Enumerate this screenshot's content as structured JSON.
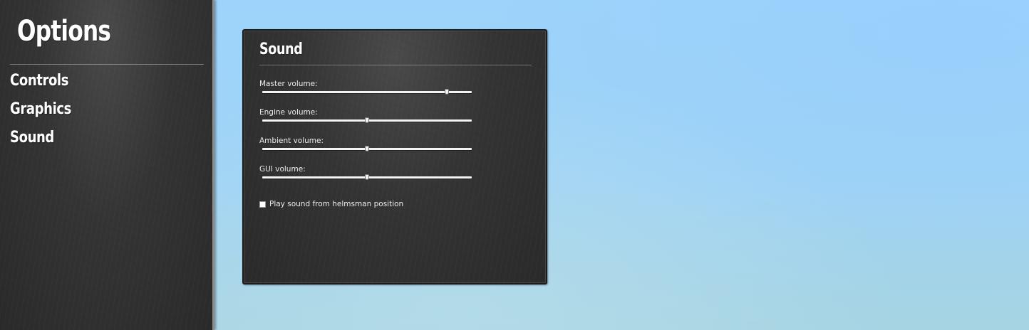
{
  "sidebar": {
    "title": "Options",
    "items": [
      {
        "label": "Controls"
      },
      {
        "label": "Graphics"
      },
      {
        "label": "Sound"
      }
    ]
  },
  "sound_panel": {
    "title": "Sound",
    "sliders": [
      {
        "label": "Master volume:",
        "value_fraction": 0.88
      },
      {
        "label": "Engine volume:",
        "value_fraction": 0.5
      },
      {
        "label": "Ambient volume:",
        "value_fraction": 0.5
      },
      {
        "label": "GUI volume:",
        "value_fraction": 0.5
      }
    ],
    "checkbox": {
      "label": "Play sound from helmsman position",
      "checked": false
    }
  }
}
